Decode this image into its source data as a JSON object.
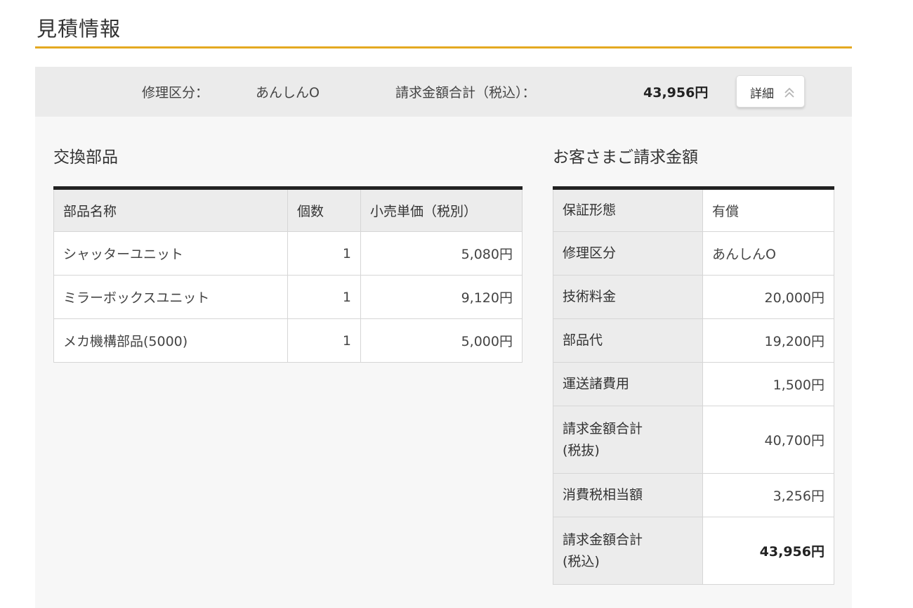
{
  "page_title": "見積情報",
  "accent_color": "#e4a921",
  "summary": {
    "repair_label": "修理区分：",
    "repair_value": "あんしんO",
    "total_label": "請求金額合計（税込）：",
    "total_value": "43,956円",
    "detail_button_label": "詳細",
    "detail_button_icon": "double-chevron-up-icon"
  },
  "parts": {
    "title": "交換部品",
    "headers": [
      "部品名称",
      "個数",
      "小売単価（税別）"
    ],
    "rows": [
      [
        "シャッターユニット",
        "1",
        "5,080円"
      ],
      [
        "ミラーボックスユニット",
        "1",
        "9,120円"
      ],
      [
        "メカ機構部品(5000)",
        "1",
        "5,000円"
      ]
    ]
  },
  "billing": {
    "title": "お客さまご請求金額",
    "rows": [
      {
        "label": "保証形態",
        "value": "有償"
      },
      {
        "label": "修理区分",
        "value": "あんしんO"
      },
      {
        "label": "技術料金",
        "value": "20,000円"
      },
      {
        "label": "部品代",
        "value": "19,200円"
      },
      {
        "label": "運送諸費用",
        "value": "1,500円"
      },
      {
        "label_line1": "請求金額合計",
        "label_line2": "(税抜)",
        "value": "40,700円"
      },
      {
        "label": "消費税相当額",
        "value": "3,256円"
      },
      {
        "label_line1": "請求金額合計",
        "label_line2": "(税込)",
        "value": "43,956円"
      }
    ]
  }
}
